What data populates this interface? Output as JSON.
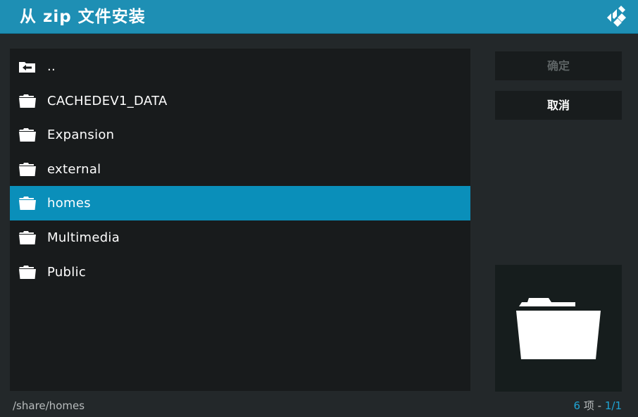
{
  "header": {
    "title": "从 zip 文件安装",
    "logo_icon": "kodi-logo-icon"
  },
  "files": [
    {
      "label": "..",
      "icon": "back-folder-icon",
      "selected": false
    },
    {
      "label": "CACHEDEV1_DATA",
      "icon": "folder-icon",
      "selected": false
    },
    {
      "label": "Expansion",
      "icon": "folder-icon",
      "selected": false
    },
    {
      "label": "external",
      "icon": "folder-icon",
      "selected": false
    },
    {
      "label": "homes",
      "icon": "folder-icon",
      "selected": true
    },
    {
      "label": "Multimedia",
      "icon": "folder-icon",
      "selected": false
    },
    {
      "label": "Public",
      "icon": "folder-icon",
      "selected": false
    }
  ],
  "buttons": {
    "ok": "确定",
    "cancel": "取消"
  },
  "preview": {
    "icon": "folder-icon"
  },
  "footer": {
    "path": "/share/homes",
    "count": "6",
    "count_unit": "项",
    "separator": "-",
    "page": "1/1"
  },
  "colors": {
    "accent": "#1e8fb4",
    "selected_row": "#0a8fba",
    "background": "#23282a",
    "panel": "#181b1c"
  }
}
